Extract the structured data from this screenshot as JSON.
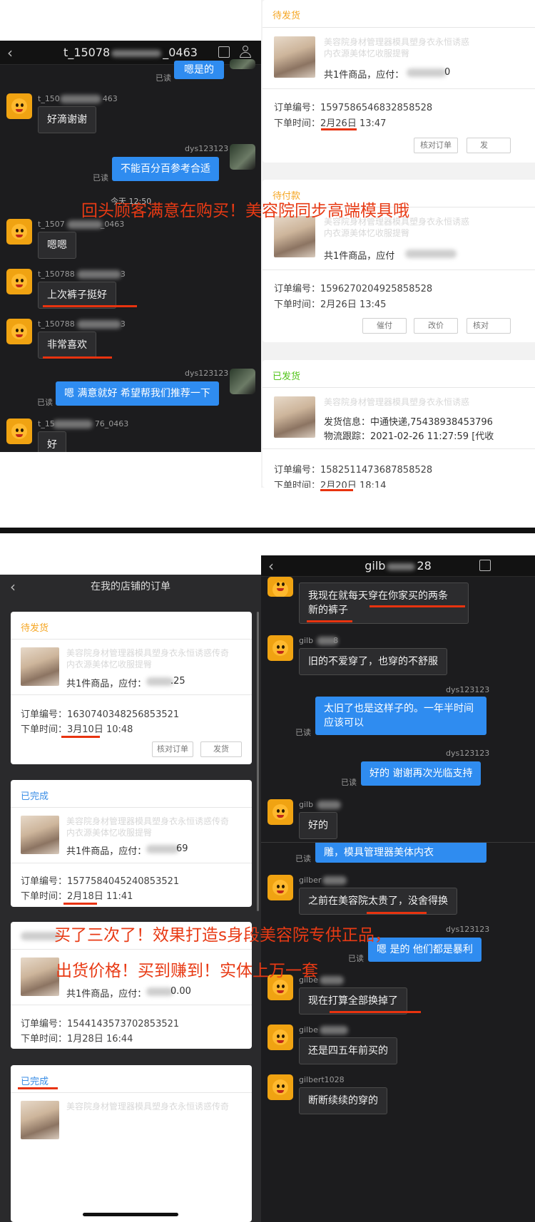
{
  "overlays": {
    "top": "回头顾客满意在购买！美容院同步高端模具哦",
    "bottom_1": "买了三次了！效果打造s身段美容院专供正品，",
    "bottom_2": "出货价格！买到赚到！实体上万一套"
  },
  "chat1": {
    "title": "t_15078",
    "title_suffix": "_0463",
    "messages": {
      "m0": "嗯是的",
      "m1_name": "t_150",
      "m1_name_suffix": "463",
      "m1": "好滴谢谢",
      "m2_name": "dys123123",
      "m2": "不能百分百参考合适",
      "time": "今天 12:50",
      "m3_name": "t_1507",
      "m3_name_suffix": "_0463",
      "m3": "嗯嗯",
      "m4_name": "t_150788",
      "m4_name_suffix": "3",
      "m4": "上次裤子挺好",
      "m5_name": "t_150788",
      "m5_name_suffix": "3",
      "m5": "非常喜欢",
      "m6_name": "dys123123",
      "m6": "嗯 满意就好 希望帮我们推荐一下",
      "m7_name": "t_15",
      "m7_name_suffix": "76_0463",
      "m7": "好"
    },
    "read": "已读"
  },
  "orders_top": {
    "o1": {
      "status": "待发货",
      "ghost_1": "美容院身材管理器模具塑身衣永恒诱惑",
      "ghost_2": "内衣源美体忆收服提臀",
      "qty": "共1件商品，应付：",
      "price_suffix": "0",
      "order_no": "订单编号：1597586546832858528",
      "time_label": "下单时间：",
      "date": "2月26日",
      "time": "13:47",
      "btn_check": "核对订单",
      "btn_ship": "发"
    },
    "o2": {
      "status": "待付款",
      "ghost_1": "美容院身材管理器模具塑身衣永恒诱惑",
      "ghost_2": "内衣源美体忆收服提臀",
      "qty": "共1件商品，应付",
      "order_no": "订单编号：1596270204925858528",
      "time_label": "下单时间：",
      "datetime": "2月26日  13:45",
      "btn_remind": "催付",
      "btn_price": "改价",
      "btn_check": "核对"
    },
    "o3": {
      "status": "已发货",
      "ghost_1": "美容院身材管理器模具塑身衣永恒诱惑",
      "ship_info": "发货信息：中通快递,75438938453796",
      "tracking": "物流跟踪：2021-02-26 11:27:59 [代收",
      "order_no": "订单编号：1582511473687858528",
      "time_label": "下单时间：",
      "date": "2月20日",
      "time": "18:14"
    }
  },
  "shop_orders": {
    "title": "在我的店铺的订单",
    "o1": {
      "status": "待发货",
      "ghost_1": "美容院身材管理器模具塑身衣永恒诱惑传奇",
      "ghost_2": "内衣源美体忆收服提臀",
      "qty": "共1件商品，应付：",
      "price_suffix": ".25",
      "order_no": "订单编号：1630740348256853521",
      "time_label": "下单时间：",
      "date": "3月10日",
      "time": "10:48",
      "btn_check": "核对订单",
      "btn_ship": "发货"
    },
    "o2": {
      "status": "已完成",
      "ghost_1": "美容院身材管理器模具塑身衣永恒诱惑传奇",
      "ghost_2": "内衣源美体忆收服提臀",
      "qty": "共1件商品，应付：",
      "price_suffix": "69",
      "order_no": "订单编号：1577584045240853521",
      "time_label": "下单时间：",
      "date": "2月18日",
      "time": "11:41"
    },
    "o3": {
      "qty": "共1件商品，应付：",
      "price_suffix": "0.00",
      "order_no": "订单编号：1544143573702853521",
      "datetime": "下单时间：1月28日  16:44"
    },
    "o4": {
      "status": "已完成",
      "ghost_1": "美容院身材管理器模具塑身衣永恒诱惑传奇"
    }
  },
  "chat2": {
    "title": "gilb",
    "title_suffix": "28",
    "messages": {
      "a1_l1": "我现在就每天穿在你家买的两条",
      "a1_l2": "新的裤子",
      "a2_name": "gilb",
      "a2_name_suffix": "8",
      "a2": "旧的不爱穿了，也穿的不舒服",
      "a3_name": "dys123123",
      "a3": "太旧了也是这样子的。一年半时间应该可以",
      "a4_name": "dys123123",
      "a4": "好的 谢谢再次光临支持",
      "a5_name": "gilb",
      "a5": "好的",
      "a6": "雕，模具管理器美体内衣",
      "a7_name": "gilber",
      "a7": "之前在美容院太贵了，没舍得换",
      "a8_name": "dys123123",
      "a8": "嗯 是的 他们都是暴利",
      "a9_name": "gilbe",
      "a9": "现在打算全部换掉了",
      "a10_name": "gilbe",
      "a10": "还是四五年前买的",
      "a11_name": "gilbert1028",
      "a11": "断断续续的穿的"
    },
    "read": "已读"
  },
  "colors": {
    "accent_red": "#e8330f",
    "bubble_blue": "#2f8cf0",
    "status_orange": "#f5a623",
    "status_green": "#52c41a",
    "status_blue": "#3a8ee6"
  }
}
